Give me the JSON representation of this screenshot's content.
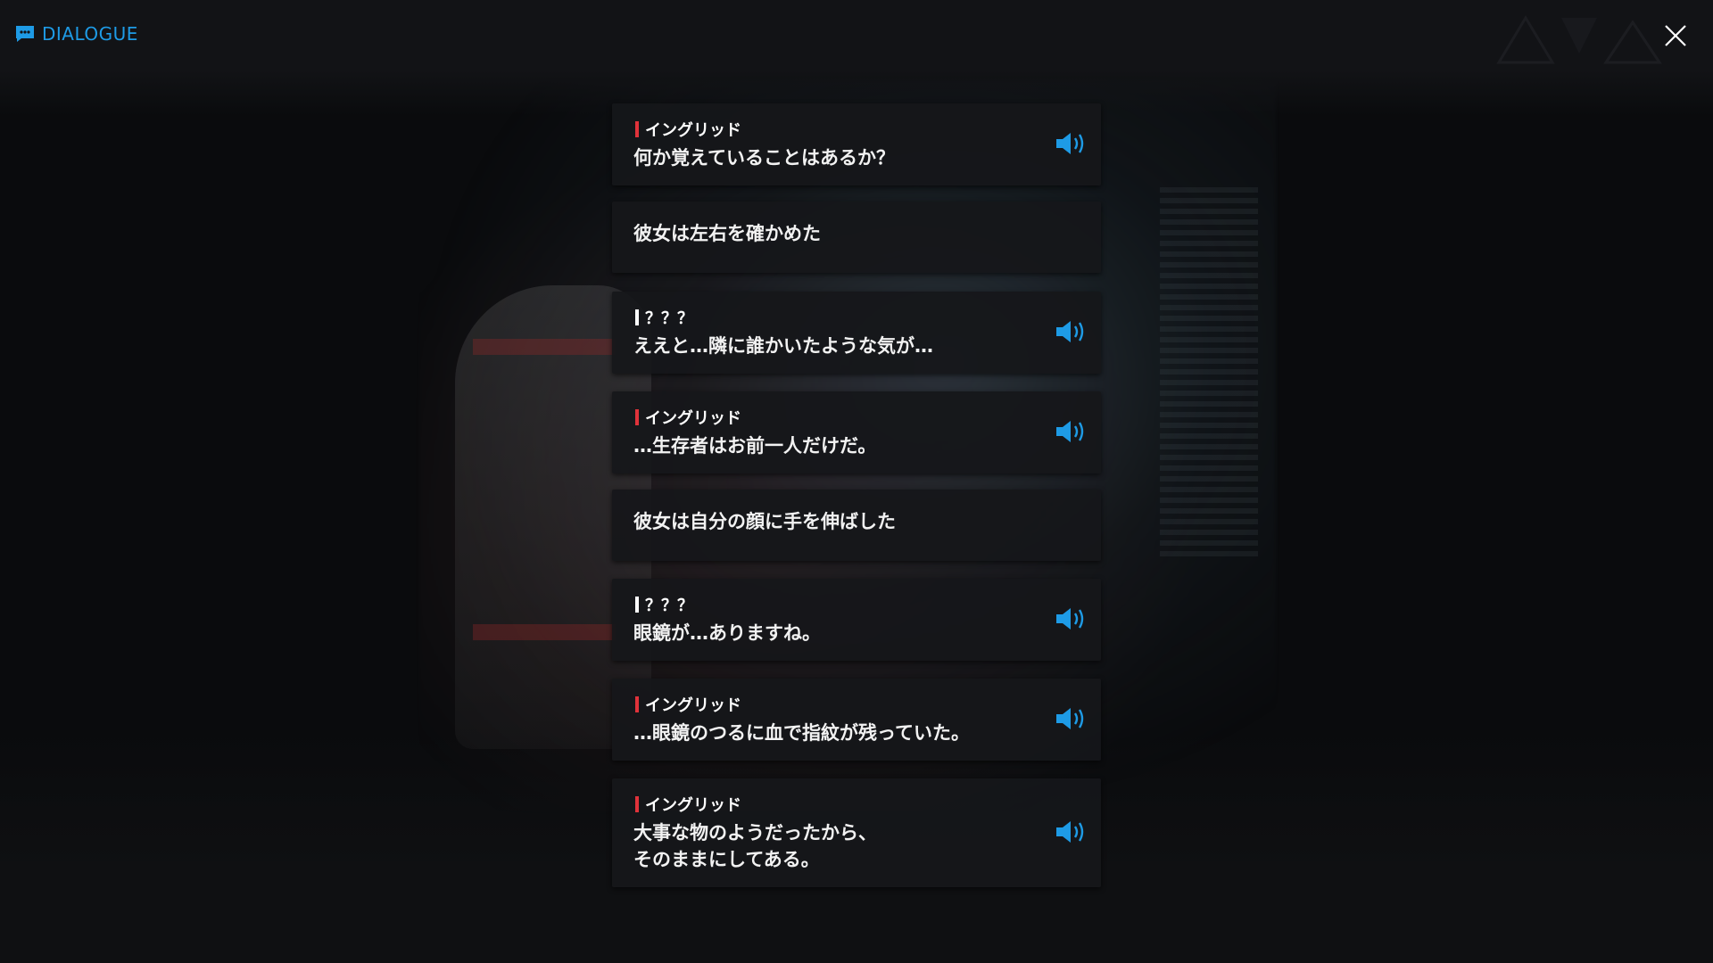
{
  "header": {
    "title": "DIALOGUE",
    "accent_color": "#1e9be6",
    "icon": "chat-bubble-icon"
  },
  "close_button": {
    "icon": "close-icon"
  },
  "dialogue": [
    {
      "type": "spoken",
      "speaker": "イングリッド",
      "speaker_color": "#e0323a",
      "text": "何か覚えていることはあるか？",
      "voice": true
    },
    {
      "type": "narration",
      "text": "彼女は左右を確かめた"
    },
    {
      "type": "spoken",
      "speaker": "？？？",
      "speaker_color": "#ffffff",
      "text": "ええと…隣に誰かいたような気が…",
      "voice": true
    },
    {
      "type": "spoken",
      "speaker": "イングリッド",
      "speaker_color": "#e0323a",
      "text": "…生存者はお前一人だけだ。",
      "voice": true
    },
    {
      "type": "narration",
      "text": "彼女は自分の顔に手を伸ばした"
    },
    {
      "type": "spoken",
      "speaker": "？？？",
      "speaker_color": "#ffffff",
      "text": "眼鏡が…ありますね。",
      "voice": true
    },
    {
      "type": "spoken",
      "speaker": "イングリッド",
      "speaker_color": "#e0323a",
      "text": "…眼鏡のつるに血で指紋が残っていた。",
      "voice": true
    },
    {
      "type": "spoken",
      "speaker": "イングリッド",
      "speaker_color": "#e0323a",
      "text": "大事な物のようだったから、\nそのままにしてある。",
      "voice": true
    }
  ],
  "voice_icon": "speaker-volume-icon",
  "voice_color": "#1e9be6"
}
